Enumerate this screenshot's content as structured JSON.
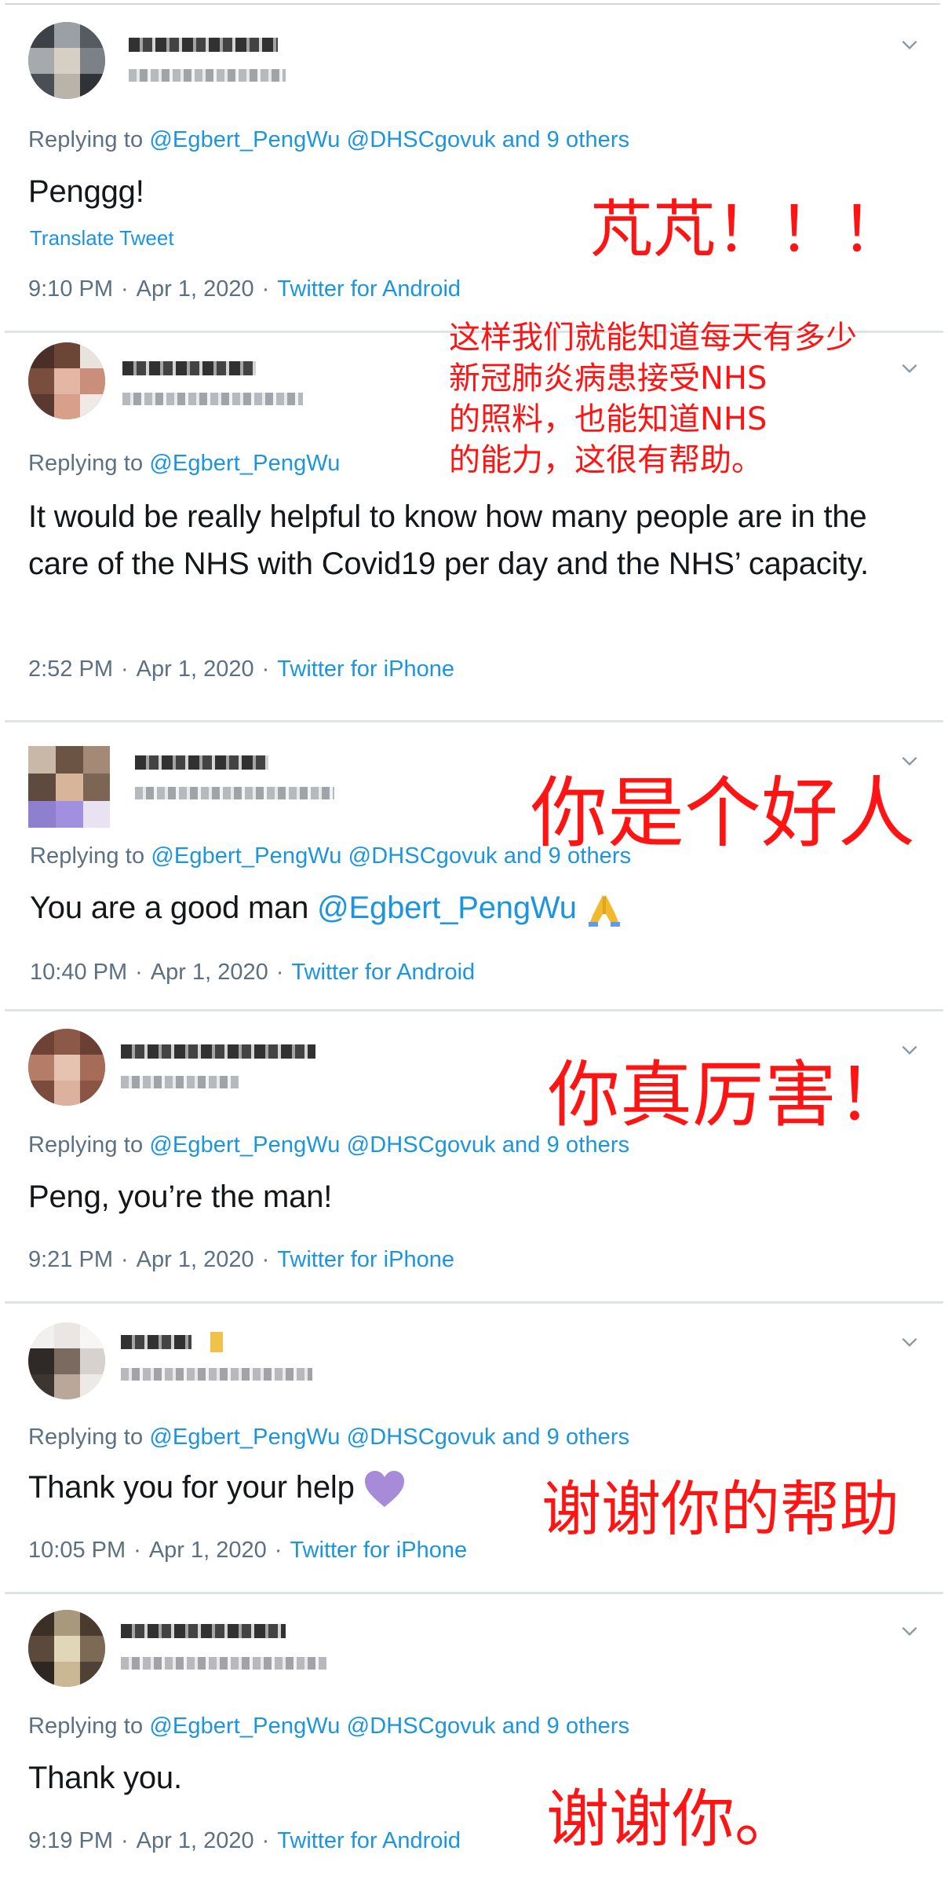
{
  "tweets": [
    {
      "replying_prefix": "Replying to",
      "mentions": [
        "@Egbert_PengWu",
        "@DHSCgovuk"
      ],
      "others": "and 9 others",
      "body": "Penggg!",
      "translate": "Translate Tweet",
      "time": "9:10 PM",
      "date": "Apr 1, 2020",
      "client": "Twitter for Android",
      "annotation": "芃芃！！！"
    },
    {
      "replying_prefix": "Replying to",
      "mentions": [
        "@Egbert_PengWu"
      ],
      "body": "It would be really helpful to know how many people are in the care of the NHS with Covid19 per day and the NHS’ capacity.",
      "time": "2:52 PM",
      "date": "Apr 1, 2020",
      "client": "Twitter for iPhone",
      "annotation_lines": [
        "这样我们就能知道每天有多少",
        "新冠肺炎病患接受NHS",
        "的照料，也能知道NHS",
        "的能力，这很有帮助。"
      ]
    },
    {
      "replying_prefix": "Replying to",
      "mentions": [
        "@Egbert_PengWu",
        "@DHSCgovuk"
      ],
      "others": "and 9 others",
      "body": "You are a good man",
      "body_mention": "@Egbert_PengWu",
      "emoji": "folded-hands-emoji",
      "time": "10:40 PM",
      "date": "Apr 1, 2020",
      "client": "Twitter for Android",
      "annotation": "你是个好人"
    },
    {
      "replying_prefix": "Replying to",
      "mentions": [
        "@Egbert_PengWu",
        "@DHSCgovuk"
      ],
      "others": "and 9 others",
      "body": "Peng, you’re the man!",
      "time": "9:21 PM",
      "date": "Apr 1, 2020",
      "client": "Twitter for iPhone",
      "annotation": "你真厉害！"
    },
    {
      "replying_prefix": "Replying to",
      "mentions": [
        "@Egbert_PengWu",
        "@DHSCgovuk"
      ],
      "others": "and 9 others",
      "body": "Thank you for your help",
      "emoji": "purple-heart-emoji",
      "time": "10:05 PM",
      "date": "Apr 1, 2020",
      "client": "Twitter for iPhone",
      "annotation": "谢谢你的帮助"
    },
    {
      "replying_prefix": "Replying to",
      "mentions": [
        "@Egbert_PengWu",
        "@DHSCgovuk"
      ],
      "others": "and 9 others",
      "body": "Thank you.",
      "time": "9:19 PM",
      "date": "Apr 1, 2020",
      "client": "Twitter for Android",
      "annotation": "谢谢你。"
    }
  ],
  "separator": "·",
  "colors": {
    "link": "#1b95e0",
    "meta": "#5b7083",
    "body": "#14171a",
    "annotation": "#ff1414",
    "heart": "#a78bd9",
    "hands": "#f2b92e"
  },
  "icons": [
    "chevron-down-icon",
    "avatar",
    "folded-hands-emoji",
    "purple-heart-emoji"
  ]
}
